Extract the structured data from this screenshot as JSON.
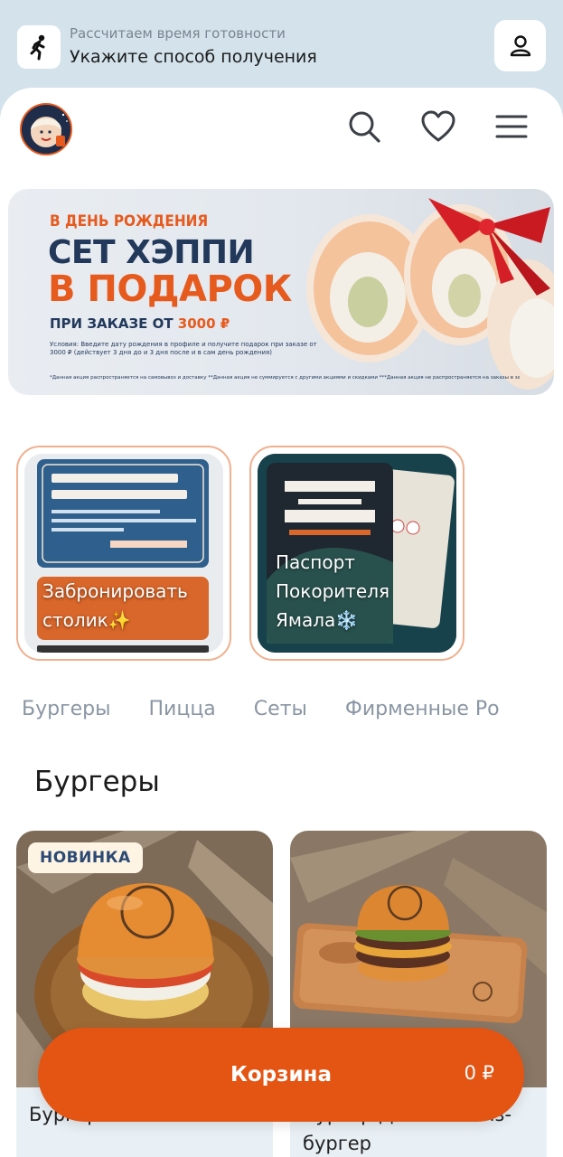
{
  "topbar": {
    "subtitle": "Рассчитаем время готовности",
    "title": "Укажите способ получения"
  },
  "banner": {
    "line1": "В ДЕНЬ РОЖДЕНИЯ",
    "line2": "СЕТ ХЭППИ",
    "line3": "В ПОДАРОК",
    "line4_prefix": "ПРИ ЗАКАЗЕ ОТ ",
    "line4_amount": "3000 ₽",
    "conditions": "Условия: Введите дату рождения в профиле и получите подарок при заказе от 3000 ₽ (действует 3 дня до и 3 дня после и в сам день рождения)",
    "footnote": "*Данная акция распространяется на самовывоз и доставку **Данная акция не суммируется с другими акциями и скидками ***Данная акция не распространяется на заказы в зале"
  },
  "stories": [
    {
      "title": "Забронировать столик✨"
    },
    {
      "title": "Паспорт Покорителя Ямала❄️"
    }
  ],
  "categories": [
    "Бургеры",
    "Пицца",
    "Сеты",
    "Фирменные Ро"
  ],
  "section_title": "Бургеры",
  "products": [
    {
      "badge": "НОВИНКА",
      "name": "Бургер"
    },
    {
      "name": "Бургер Двойной чиз-бургер"
    }
  ],
  "cart": {
    "label": "Корзина",
    "total": "0 ₽"
  },
  "colors": {
    "accent": "#e45413",
    "navy": "#22395c",
    "header_bg": "#d3e2eb"
  }
}
